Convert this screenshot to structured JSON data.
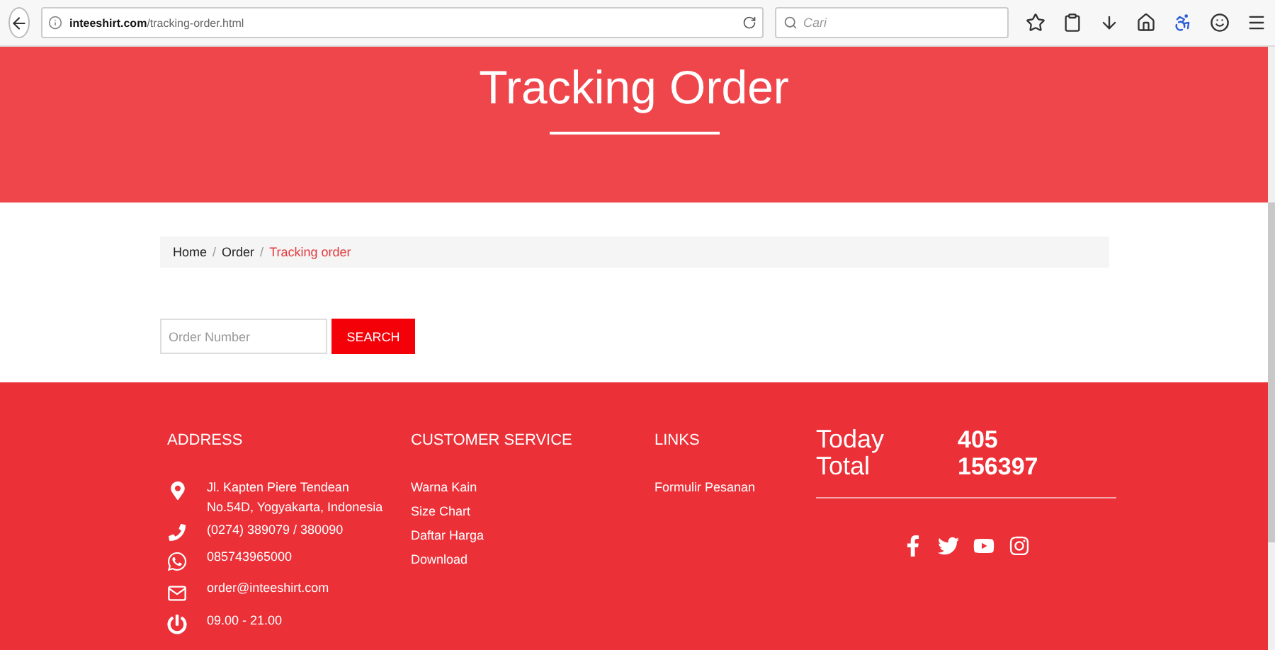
{
  "browser": {
    "url_host": "inteeshirt.com",
    "url_path": "/tracking-order.html",
    "search_placeholder": "Cari"
  },
  "hero": {
    "title": "Tracking Order"
  },
  "breadcrumb_separator": "/",
  "breadcrumb": [
    {
      "label": "Home",
      "selected": false
    },
    {
      "label": "Order",
      "selected": false
    },
    {
      "label": "Tracking order",
      "selected": true
    }
  ],
  "search_form": {
    "placeholder": "Order Number",
    "button": "SEARCH"
  },
  "footer": {
    "address": {
      "heading": "ADDRESS",
      "items": [
        {
          "kind": "location",
          "lines": [
            "Jl. Kapten Piere Tendean",
            "No.54D, Yogyakarta, Indonesia"
          ]
        },
        {
          "kind": "phone",
          "lines": [
            "(0274) 389079 / 380090"
          ]
        },
        {
          "kind": "whatsapp",
          "lines": [
            "085743965000"
          ]
        },
        {
          "kind": "email",
          "lines": [
            "order@inteeshirt.com"
          ]
        },
        {
          "kind": "hours",
          "lines": [
            "09.00 - 21.00"
          ]
        }
      ]
    },
    "customer_service": {
      "heading": "CUSTOMER SERVICE",
      "links": [
        "Warna Kain",
        "Size Chart",
        "Daftar Harga",
        "Download"
      ]
    },
    "links": {
      "heading": "LINKS",
      "links": [
        "Formulir Pesanan"
      ]
    },
    "counter": [
      {
        "label": "Today",
        "value": "405"
      },
      {
        "label": "Total",
        "value": "156397"
      }
    ],
    "social": [
      {
        "kind": "facebook"
      },
      {
        "kind": "twitter"
      },
      {
        "kind": "youtube"
      },
      {
        "kind": "instagram"
      }
    ]
  }
}
